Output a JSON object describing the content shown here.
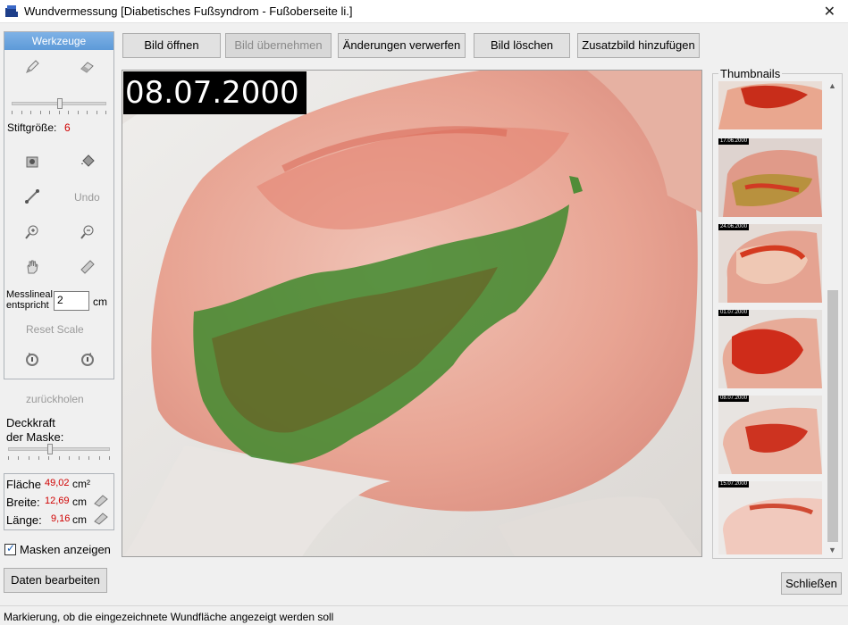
{
  "window": {
    "title": "Wundvermessung [Diabetisches Fußsyndrom - Fußoberseite li.]",
    "close_glyph": "✕"
  },
  "tools": {
    "header": "Werkzeuge",
    "pen_size_label": "Stiftgröße:",
    "pen_size_value": "6",
    "undo_label": "Undo",
    "ruler_label_line1": "Messlineal",
    "ruler_label_line2": "entspricht",
    "ruler_value": "2",
    "ruler_unit": "cm",
    "reset_scale_label": "Reset Scale",
    "icons": [
      "pen-icon",
      "eraser-icon",
      "fill-icon",
      "paint-bucket-icon",
      "line-icon",
      "zoom-in-icon",
      "zoom-out-icon",
      "hand-icon",
      "ruler-icon",
      "rotate-left-icon",
      "rotate-right-icon"
    ]
  },
  "restore_label": "zurückholen",
  "opacity": {
    "label_line1": "Deckkraft",
    "label_line2": "der Maske:",
    "level": 0.4
  },
  "pen_size_slider_level": 0.5,
  "measurements": {
    "area_label": "Fläche",
    "area_value": "49,02",
    "area_unit": "cm²",
    "width_label": "Breite:",
    "width_value": "12,69",
    "width_unit": "cm",
    "length_label": "Länge:",
    "length_value": "9,16",
    "length_unit": "cm"
  },
  "show_masks": {
    "label": "Masken anzeigen",
    "checked": true
  },
  "toolbar": {
    "open": "Bild öffnen",
    "accept": "Bild übernehmen",
    "discard": "Änderungen verwerfen",
    "delete": "Bild löschen",
    "add": "Zusatzbild hinzufügen"
  },
  "image": {
    "date": "08.07.2000"
  },
  "thumbnails": {
    "legend": "Thumbnails",
    "items": [
      {
        "date": ""
      },
      {
        "date": "17.06.2000"
      },
      {
        "date": "24.06.2000"
      },
      {
        "date": "01.07.2000"
      },
      {
        "date": "08.07.2000"
      },
      {
        "date": "15.07.2000"
      }
    ]
  },
  "buttons": {
    "edit_data": "Daten bearbeiten",
    "close": "Schließen"
  },
  "status": "Markierung, ob die eingezeichnete Wundfläche angezeigt werden soll",
  "colors": {
    "accent_header": "#5d9ad8",
    "value_red": "#d00000",
    "mask_green": "#3f8a2e"
  }
}
